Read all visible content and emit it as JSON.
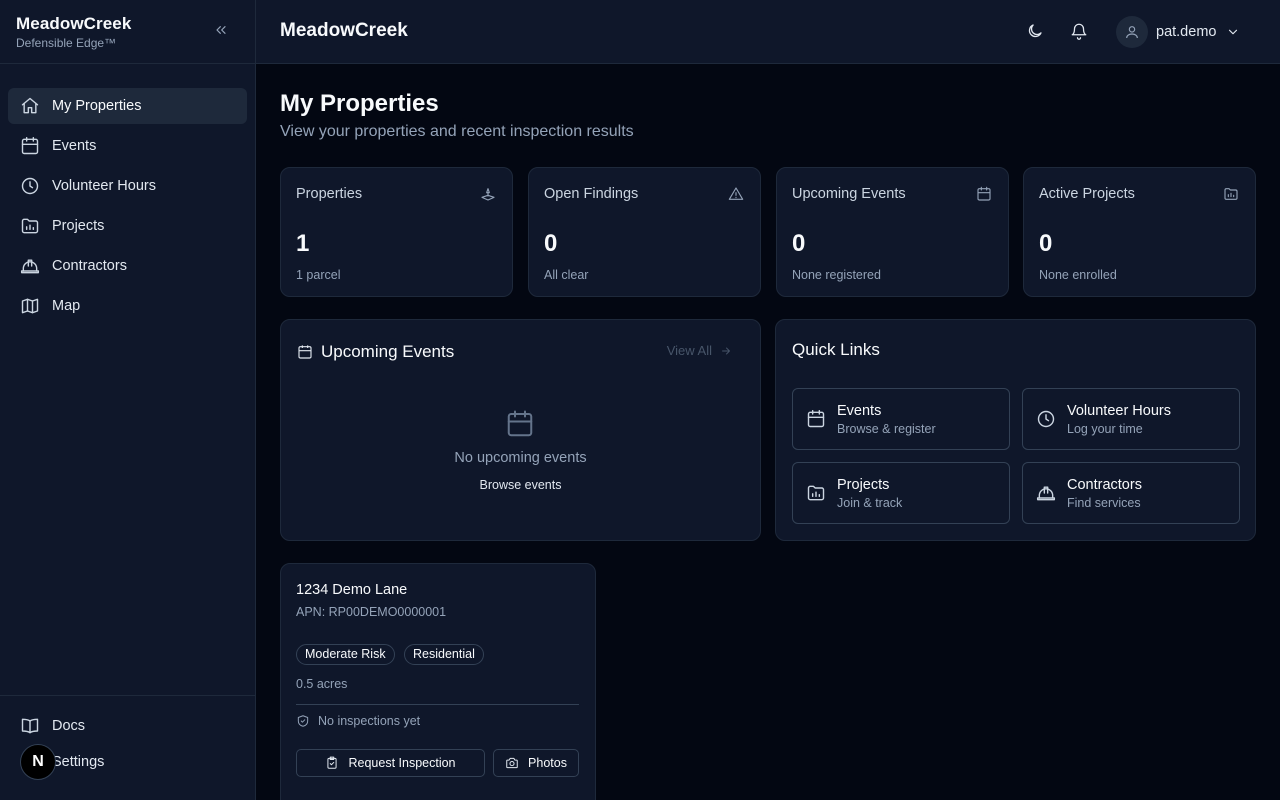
{
  "sidebar": {
    "brand_name": "MeadowCreek",
    "brand_sub": "Defensible Edge™",
    "items": [
      {
        "label": "My Properties",
        "icon": "home-icon"
      },
      {
        "label": "Events",
        "icon": "calendar-icon"
      },
      {
        "label": "Volunteer Hours",
        "icon": "clock-icon"
      },
      {
        "label": "Projects",
        "icon": "folder-chart-icon"
      },
      {
        "label": "Contractors",
        "icon": "hard-hat-icon"
      },
      {
        "label": "Map",
        "icon": "map-icon"
      }
    ],
    "bottom_items": [
      {
        "label": "Docs",
        "icon": "book-icon"
      },
      {
        "label": "Settings",
        "icon": "gear-icon"
      }
    ],
    "dev_badge": "N"
  },
  "header": {
    "title": "MeadowCreek",
    "username": "pat.demo"
  },
  "page": {
    "title": "My Properties",
    "subtitle": "View your properties and recent inspection results"
  },
  "stats": [
    {
      "label": "Properties",
      "value": "1",
      "caption": "1 parcel",
      "icon": "landplot-icon"
    },
    {
      "label": "Open Findings",
      "value": "0",
      "caption": "All clear",
      "icon": "alert-triangle-icon"
    },
    {
      "label": "Upcoming Events",
      "value": "0",
      "caption": "None registered",
      "icon": "calendar-icon"
    },
    {
      "label": "Active Projects",
      "value": "0",
      "caption": "None enrolled",
      "icon": "folder-chart-icon"
    }
  ],
  "upcoming_events": {
    "title": "Upcoming Events",
    "view_all": "View All",
    "empty_text": "No upcoming events",
    "browse_link": "Browse events"
  },
  "quick_links": {
    "title": "Quick Links",
    "items": [
      {
        "name": "Events",
        "desc": "Browse & register",
        "icon": "calendar-icon"
      },
      {
        "name": "Volunteer Hours",
        "desc": "Log your time",
        "icon": "clock-icon"
      },
      {
        "name": "Projects",
        "desc": "Join & track",
        "icon": "folder-chart-icon"
      },
      {
        "name": "Contractors",
        "desc": "Find services",
        "icon": "hard-hat-icon"
      }
    ]
  },
  "property": {
    "name": "1234 Demo Lane",
    "apn": "APN: RP00DEMO0000001",
    "badges": [
      "Moderate Risk",
      "Residential"
    ],
    "acres": "0.5 acres",
    "inspection_status": "No inspections yet",
    "request_button": "Request Inspection",
    "photos_button": "Photos"
  }
}
